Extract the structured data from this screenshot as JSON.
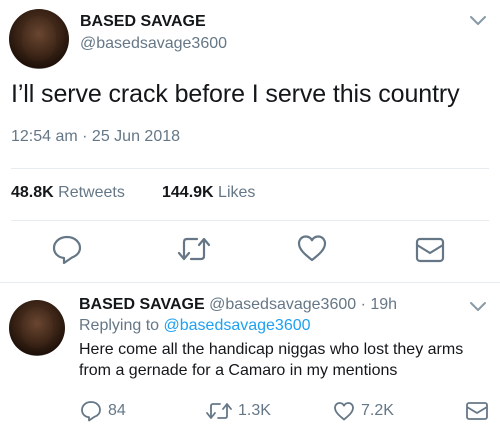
{
  "tweet": {
    "author_name": "BASED SAVAGE",
    "author_handle": "@basedsavage3600",
    "text": "I’ll serve crack before I serve this country",
    "timestamp": "12:54 am · 25 Jun 2018",
    "retweets_count": "48.8K",
    "retweets_label": "Retweets",
    "likes_count": "144.9K",
    "likes_label": "Likes",
    "icons": [
      "chevron-down-icon",
      "reply-icon",
      "retweet-icon",
      "like-icon",
      "share-icon"
    ]
  },
  "reply": {
    "author_name": "BASED SAVAGE",
    "author_handle": "@basedsavage3600",
    "time_ago": "19h",
    "replying_to_prefix": "Replying to",
    "replying_to_handle": "@basedsavage3600",
    "text_line1": "Here come all the handicap niggas who lost they arms",
    "text_line2": "from a gernade for a  Camaro in my mentions",
    "reply_count": "84",
    "retweet_count": "1.3K",
    "like_count": "7.2K"
  },
  "colors": {
    "text": "#14171a",
    "secondary": "#657786",
    "link": "#1da1f2",
    "divider": "#e6ecf0"
  }
}
